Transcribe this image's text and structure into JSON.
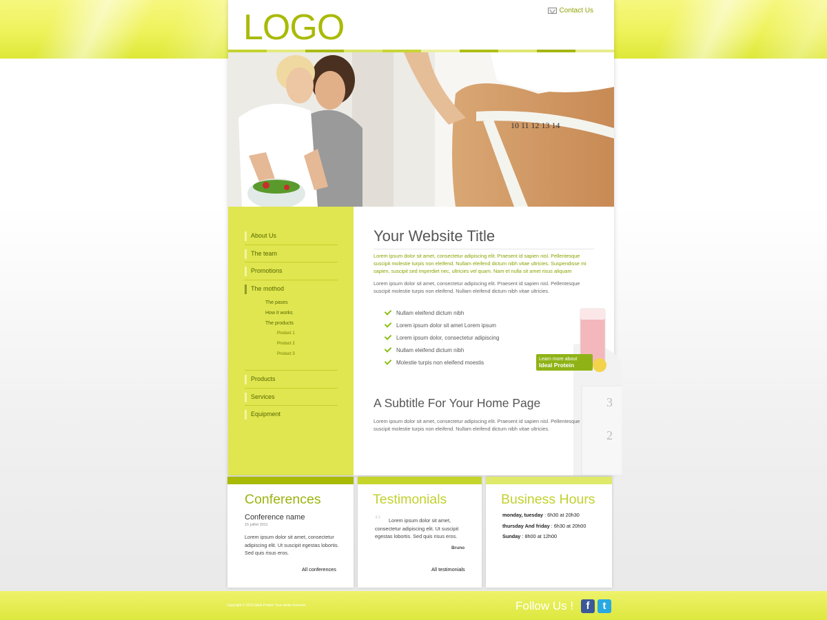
{
  "header": {
    "logo": "LOGO",
    "contact": "Contact Us"
  },
  "nav": {
    "items": [
      {
        "label": "About Us"
      },
      {
        "label": "The team"
      },
      {
        "label": "Promotions"
      },
      {
        "label": "The mothod"
      }
    ],
    "sub_items": [
      "The pases",
      "How it works",
      "The products"
    ],
    "sub_sub_items": [
      "Product 1",
      "Product 2",
      "Product 3"
    ],
    "lower_items": [
      "Products",
      "Services",
      "Equipment"
    ]
  },
  "main": {
    "title": "Your Website Title",
    "intro_green": "Lorem ipsum dolor sit amet, consectetur adipiscing elit. Praesent id sapien nisl. Pellentesque suscipit molestie turpis non eleifend. Nullam eleifend dictum nibh vitae ultricies. Suspendisse mi sapien, suscipit sed imperdiet nec, ultricies vel quam. Nam et nulla sit amet risus aliquam",
    "intro_gray": "Lorem ipsum dolor sit amet, consectetur adipiscing elit. Praesent id sapien nisl. Pellentesque suscipit molestie turpis non eleifend. Nullam eleifend dictum nibh vitae ultricies.",
    "checklist": [
      "Nullam eleifend dictum nibh",
      "Lorem ipsum dolor sit amet Lorem ipsum",
      "Lorem ipsum dolor, consectetur adipiscing",
      "Nullam eleifend dictum nibh",
      "Molestie turpis non eleifend moestis"
    ],
    "promo_line1": "Learn more about",
    "promo_line2": "Ideal Protein",
    "subtitle": "A Subtitle For Your Home Page",
    "subtitle_text": "Lorem ipsum dolor sit amet, consectetur adipiscing elit. Praesent id sapien nisl. Pellentesque suscipit molestie turpis non eleifend. Nullam eleifend dictum nibh vitae ultricies."
  },
  "conferences": {
    "heading": "Conferences",
    "name": "Conference name",
    "date": "15 juillet 2011",
    "text": "Lorem ipsum dolor sit amet, consectetur adipiscing elit. Ut suscipit egestas lobortis. Sed quis risus eros.",
    "link": "All conferences"
  },
  "testimonials": {
    "heading": "Testimonials",
    "text": "Lorem ipsum dolor sit amet, consectetur adipiscing elit. Ut suscipit egestas lobortis. Sed quis risus eros.",
    "author": "Bruno",
    "link": "All testimonials"
  },
  "hours": {
    "heading": "Business Hours",
    "rows": [
      {
        "day": "monday, tuesday",
        "time": " : 6h30 at 20h30"
      },
      {
        "day": "thursday And friday",
        "time": " : 6h30 at 20h00"
      },
      {
        "day": "Sunday",
        "time": " : 8h00 at 12h00"
      }
    ]
  },
  "footer": {
    "copyright": "Copyright © 2010 Ideal Protein Tous droits réservés",
    "follow": "Follow Us !",
    "facebook": "f",
    "twitter": "t"
  },
  "colors": {
    "accent_green": "#a9ba05",
    "sidebar": "#e0e64f",
    "heading_green": "#8fb317",
    "heading_light": "#c9d82c"
  },
  "icons": [
    "envelope-icon",
    "checkmark-icon",
    "quote-icon",
    "facebook-icon",
    "twitter-icon"
  ]
}
